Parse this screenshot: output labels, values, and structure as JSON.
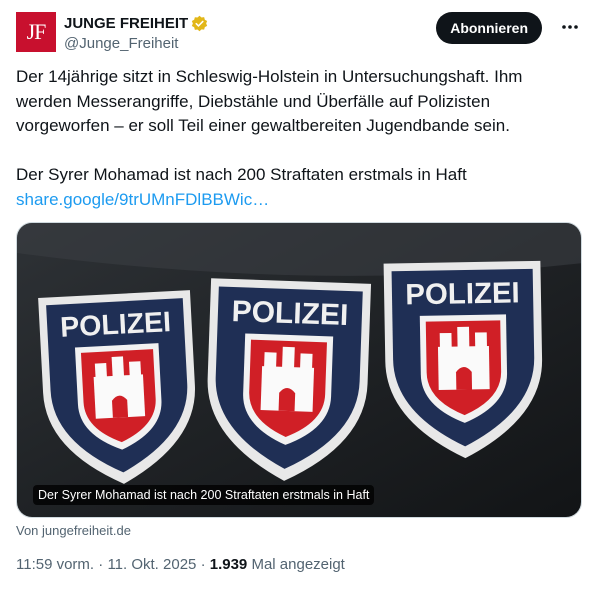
{
  "account": {
    "avatar_text": "JF",
    "display_name": "JUNGE FREIHEIT",
    "handle": "@Junge_Freiheit",
    "verified_color": "#e2b719"
  },
  "actions": {
    "follow_label": "Abonnieren",
    "more_icon": "more-horizontal-icon"
  },
  "tweet": {
    "paragraph1": "Der 14jährige sitzt in Schleswig-Holstein in Untersuchungshaft. Ihm werden Messerangriffe, Diebstähle und Überfälle auf Polizisten vorgeworfen – er soll Teil einer gewaltbereiten Jugendbande sein.",
    "paragraph2": "Der Syrer Mohamad ist nach 200 Straftaten erstmals in Haft",
    "link": "share.google/9trUMnFDlBBWic…"
  },
  "card": {
    "patch_text": "POLIZEI",
    "caption": "Der Syrer Mohamad ist nach 200 Straftaten erstmals in Haft",
    "source": "Von jungefreiheit.de"
  },
  "meta": {
    "time": "11:59 vorm.",
    "separator": "·",
    "date": "11. Okt. 2025",
    "views_count": "1.939",
    "views_label": "Mal angezeigt"
  },
  "colors": {
    "brand_red": "#c8102e",
    "link_blue": "#1d9bf0",
    "button_dark": "#0f1419",
    "patch_navy": "#1f2f55"
  }
}
